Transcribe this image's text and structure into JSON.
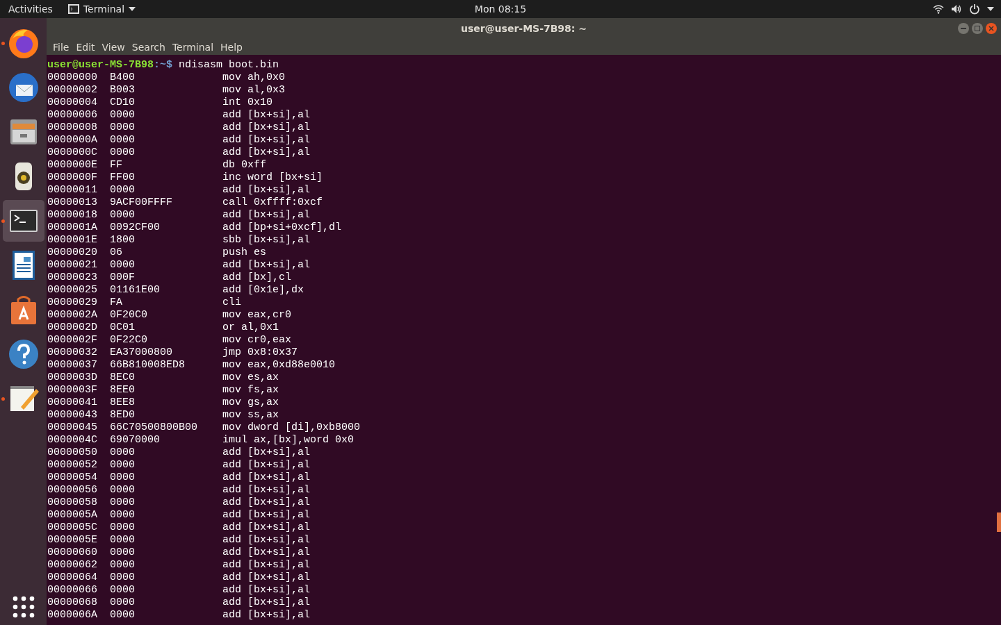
{
  "top_bar": {
    "activities": "Activities",
    "app_menu": "Terminal",
    "clock": "Mon 08:15"
  },
  "dock": {
    "items": [
      {
        "kind": "browser",
        "running": true,
        "selected": false
      },
      {
        "kind": "mail",
        "running": false,
        "selected": false
      },
      {
        "kind": "files",
        "running": false,
        "selected": false
      },
      {
        "kind": "music",
        "running": false,
        "selected": false
      },
      {
        "kind": "terminal",
        "running": true,
        "selected": true
      },
      {
        "kind": "writer",
        "running": false,
        "selected": false
      },
      {
        "kind": "store",
        "running": false,
        "selected": false
      },
      {
        "kind": "help",
        "running": false,
        "selected": false
      },
      {
        "kind": "editor",
        "running": true,
        "selected": false
      }
    ]
  },
  "window": {
    "title": "user@user-MS-7B98: ~"
  },
  "menu": [
    "File",
    "Edit",
    "View",
    "Search",
    "Terminal",
    "Help"
  ],
  "terminal": {
    "prompt_user": "user@user-MS-7B98",
    "prompt_path": ":~$",
    "command": "ndisasm boot.bin",
    "lines": [
      {
        "address": "00000000",
        "hex": "B400",
        "instruction": "mov ah,0x0"
      },
      {
        "address": "00000002",
        "hex": "B003",
        "instruction": "mov al,0x3"
      },
      {
        "address": "00000004",
        "hex": "CD10",
        "instruction": "int 0x10"
      },
      {
        "address": "00000006",
        "hex": "0000",
        "instruction": "add [bx+si],al"
      },
      {
        "address": "00000008",
        "hex": "0000",
        "instruction": "add [bx+si],al"
      },
      {
        "address": "0000000A",
        "hex": "0000",
        "instruction": "add [bx+si],al"
      },
      {
        "address": "0000000C",
        "hex": "0000",
        "instruction": "add [bx+si],al"
      },
      {
        "address": "0000000E",
        "hex": "FF",
        "instruction": "db 0xff"
      },
      {
        "address": "0000000F",
        "hex": "FF00",
        "instruction": "inc word [bx+si]"
      },
      {
        "address": "00000011",
        "hex": "0000",
        "instruction": "add [bx+si],al"
      },
      {
        "address": "00000013",
        "hex": "9ACF00FFFF",
        "instruction": "call 0xffff:0xcf"
      },
      {
        "address": "00000018",
        "hex": "0000",
        "instruction": "add [bx+si],al"
      },
      {
        "address": "0000001A",
        "hex": "0092CF00",
        "instruction": "add [bp+si+0xcf],dl"
      },
      {
        "address": "0000001E",
        "hex": "1800",
        "instruction": "sbb [bx+si],al"
      },
      {
        "address": "00000020",
        "hex": "06",
        "instruction": "push es"
      },
      {
        "address": "00000021",
        "hex": "0000",
        "instruction": "add [bx+si],al"
      },
      {
        "address": "00000023",
        "hex": "000F",
        "instruction": "add [bx],cl"
      },
      {
        "address": "00000025",
        "hex": "01161E00",
        "instruction": "add [0x1e],dx"
      },
      {
        "address": "00000029",
        "hex": "FA",
        "instruction": "cli"
      },
      {
        "address": "0000002A",
        "hex": "0F20C0",
        "instruction": "mov eax,cr0"
      },
      {
        "address": "0000002D",
        "hex": "0C01",
        "instruction": "or al,0x1"
      },
      {
        "address": "0000002F",
        "hex": "0F22C0",
        "instruction": "mov cr0,eax"
      },
      {
        "address": "00000032",
        "hex": "EA37000800",
        "instruction": "jmp 0x8:0x37"
      },
      {
        "address": "00000037",
        "hex": "66B810008ED8",
        "instruction": "mov eax,0xd88e0010"
      },
      {
        "address": "0000003D",
        "hex": "8EC0",
        "instruction": "mov es,ax"
      },
      {
        "address": "0000003F",
        "hex": "8EE0",
        "instruction": "mov fs,ax"
      },
      {
        "address": "00000041",
        "hex": "8EE8",
        "instruction": "mov gs,ax"
      },
      {
        "address": "00000043",
        "hex": "8ED0",
        "instruction": "mov ss,ax"
      },
      {
        "address": "00000045",
        "hex": "66C70500800B00",
        "instruction": "mov dword [di],0xb8000"
      },
      {
        "address": "0000004C",
        "hex": "69070000",
        "instruction": "imul ax,[bx],word 0x0"
      },
      {
        "address": "00000050",
        "hex": "0000",
        "instruction": "add [bx+si],al"
      },
      {
        "address": "00000052",
        "hex": "0000",
        "instruction": "add [bx+si],al"
      },
      {
        "address": "00000054",
        "hex": "0000",
        "instruction": "add [bx+si],al"
      },
      {
        "address": "00000056",
        "hex": "0000",
        "instruction": "add [bx+si],al"
      },
      {
        "address": "00000058",
        "hex": "0000",
        "instruction": "add [bx+si],al"
      },
      {
        "address": "0000005A",
        "hex": "0000",
        "instruction": "add [bx+si],al"
      },
      {
        "address": "0000005C",
        "hex": "0000",
        "instruction": "add [bx+si],al"
      },
      {
        "address": "0000005E",
        "hex": "0000",
        "instruction": "add [bx+si],al"
      },
      {
        "address": "00000060",
        "hex": "0000",
        "instruction": "add [bx+si],al"
      },
      {
        "address": "00000062",
        "hex": "0000",
        "instruction": "add [bx+si],al"
      },
      {
        "address": "00000064",
        "hex": "0000",
        "instruction": "add [bx+si],al"
      },
      {
        "address": "00000066",
        "hex": "0000",
        "instruction": "add [bx+si],al"
      },
      {
        "address": "00000068",
        "hex": "0000",
        "instruction": "add [bx+si],al"
      },
      {
        "address": "0000006A",
        "hex": "0000",
        "instruction": "add [bx+si],al"
      }
    ]
  }
}
